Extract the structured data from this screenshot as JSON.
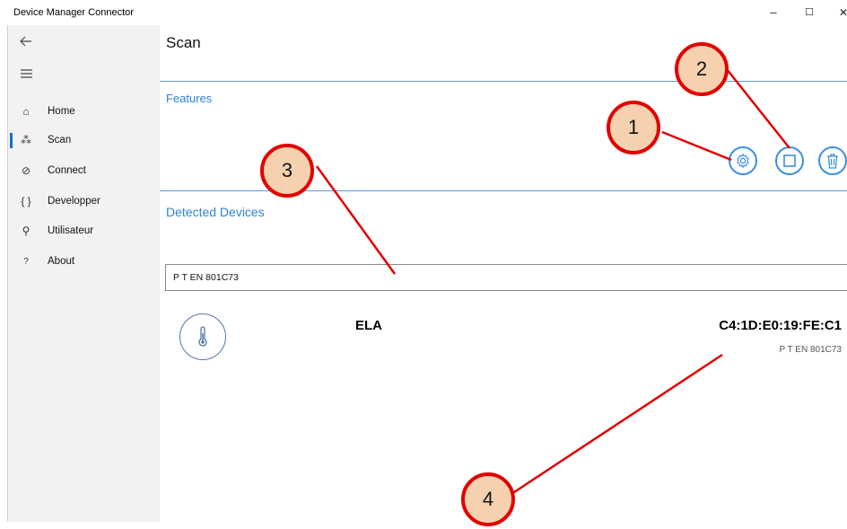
{
  "window": {
    "title": "Device Manager Connector",
    "minimize_glyph": "–",
    "maximize_glyph": "☐",
    "close_glyph": "✕"
  },
  "sidebar": {
    "back_icon": "back-arrow-icon",
    "menu_icon": "hamburger-icon",
    "items": [
      {
        "label": "Home",
        "icon": "home-icon",
        "glyph": "⌂"
      },
      {
        "label": "Scan",
        "icon": "scan-icon",
        "glyph": "⁂",
        "active": true
      },
      {
        "label": "Connect",
        "icon": "connect-icon",
        "glyph": "⊘"
      },
      {
        "label": "Developper",
        "icon": "braces-icon",
        "glyph": "{ }"
      },
      {
        "label": "Utilisateur",
        "icon": "user-icon",
        "glyph": "⚲"
      },
      {
        "label": "About",
        "icon": "question-icon",
        "glyph": "?"
      }
    ]
  },
  "main": {
    "page_title": "Scan",
    "features": {
      "title": "Features",
      "buttons": [
        {
          "icon": "settings-gear-icon"
        },
        {
          "icon": "stop-square-icon"
        },
        {
          "icon": "trash-icon"
        }
      ]
    },
    "detected": {
      "title": "Detected Devices",
      "filter_value": "P T EN 801C73",
      "devices": [
        {
          "name": "ELA",
          "mac": "C4:1D:E0:19:FE:C1",
          "id": "P T EN 801C73",
          "icon": "thermometer-icon"
        }
      ]
    }
  },
  "callouts": [
    "1",
    "2",
    "3",
    "4"
  ],
  "colors": {
    "accent": "#2f83d6",
    "callout_fill": "#f6d1b0",
    "callout_border": "#e20000"
  }
}
